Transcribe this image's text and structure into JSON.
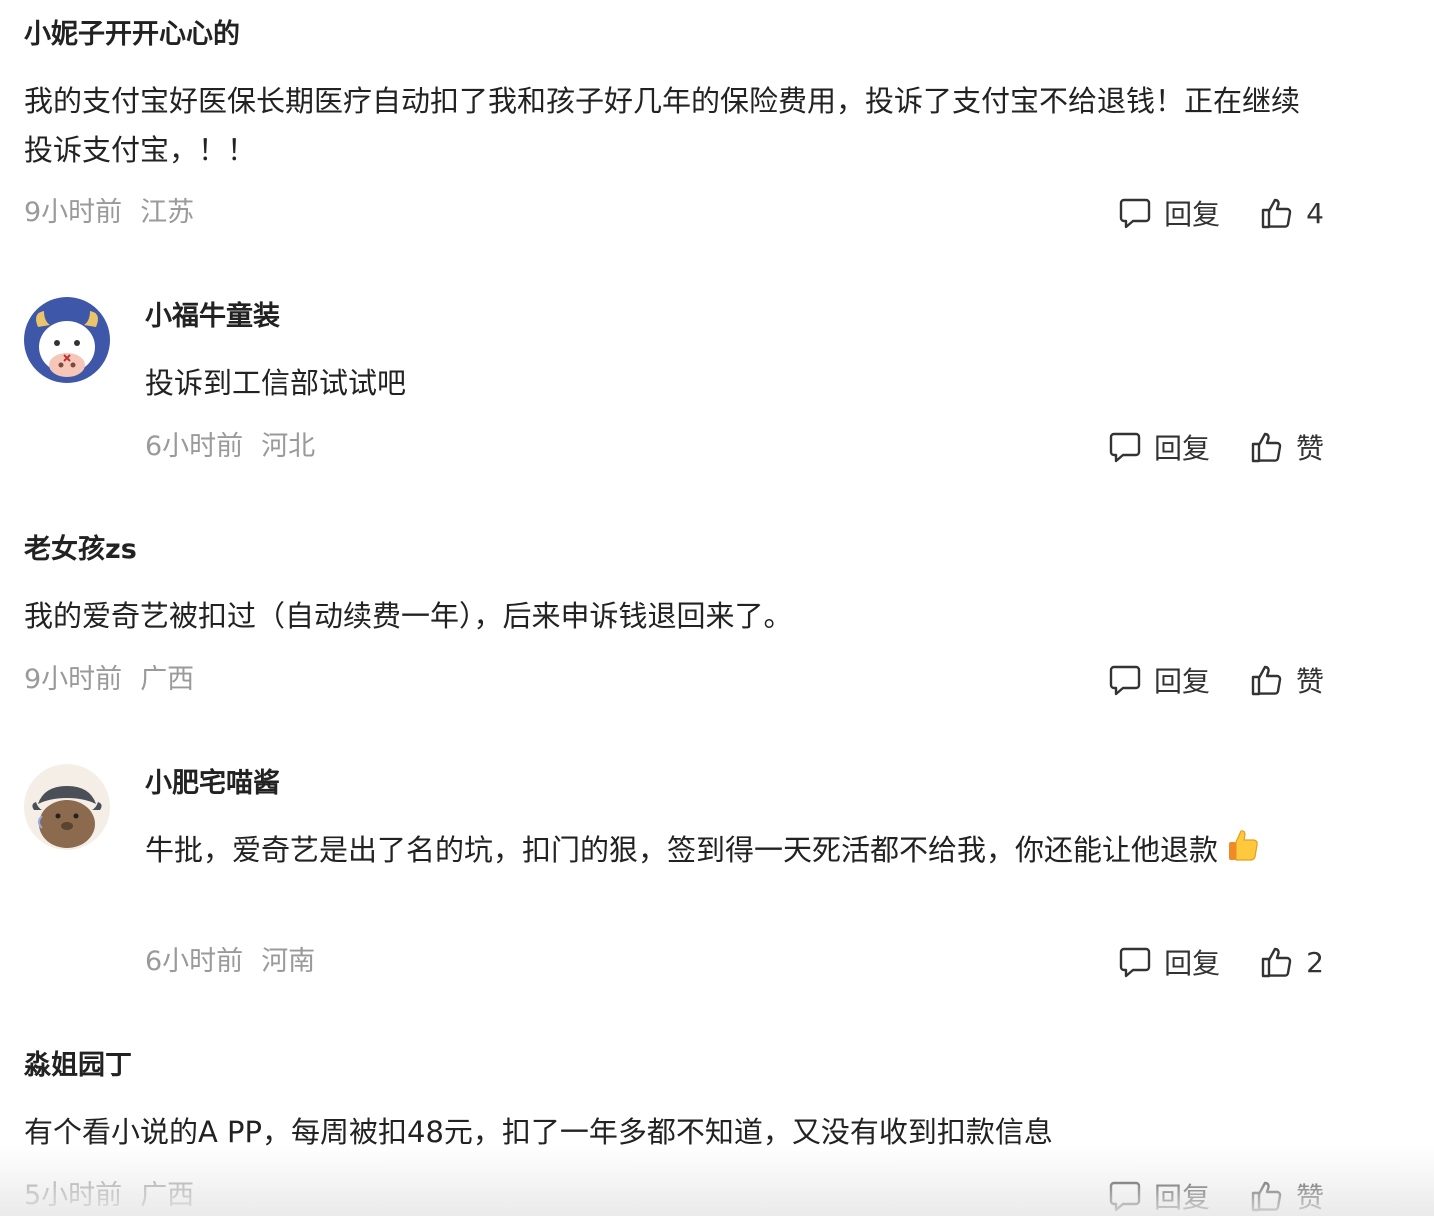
{
  "comments": [
    {
      "username": "小妮子开开心心的",
      "content": "我的支付宝好医保长期医疗自动扣了我和孩子好几年的保险费用，投诉了支付宝不给退钱！正在继续投诉支付宝，！！",
      "time": "9小时前",
      "location": "江苏",
      "reply_label": "回复",
      "like_label": "4"
    },
    {
      "username": "小福牛童装",
      "content": "投诉到工信部试试吧",
      "time": "6小时前",
      "location": "河北",
      "reply_label": "回复",
      "like_label": "赞"
    },
    {
      "username": "老女孩zs",
      "content": "我的爱奇艺被扣过（自动续费一年），后来申诉钱退回来了。",
      "time": "9小时前",
      "location": "广西",
      "reply_label": "回复",
      "like_label": "赞"
    },
    {
      "username": "小肥宅喵酱",
      "content": "牛批，爱奇艺是出了名的坑，扣门的狠，签到得一天死活都不给我，你还能让他退款",
      "time": "6小时前",
      "location": "河南",
      "reply_label": "回复",
      "like_label": "2"
    },
    {
      "username": "淼姐园丁",
      "content": "有个看小说的A PP，每周被扣48元，扣了一年多都不知道，又没有收到扣款信息",
      "time": "5小时前",
      "location": "广西",
      "reply_label": "回复",
      "like_label": "赞"
    }
  ],
  "icons": {
    "reply": "speech-bubble-icon",
    "like": "thumbs-up-icon",
    "emoji": "thumbs-up-emoji"
  },
  "colors": {
    "text": "#222222",
    "meta": "#9a9a9a",
    "avatar_cow_bg": "#3f57a8",
    "avatar_capybara_bg": "#f4eee6"
  }
}
